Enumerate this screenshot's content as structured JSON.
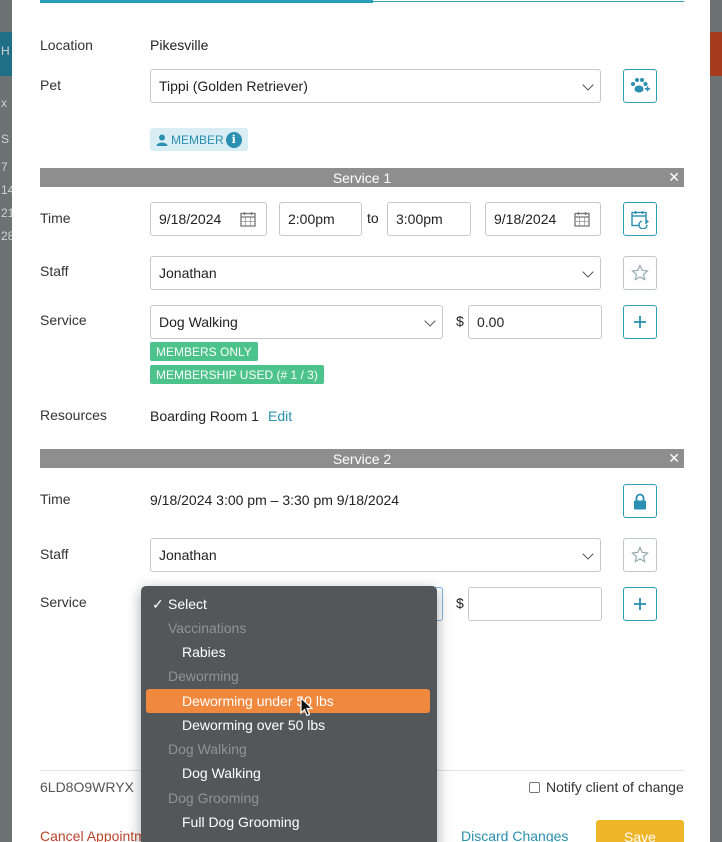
{
  "background": {
    "left_chars": [
      "H",
      "x",
      "S",
      "7",
      "14",
      "21",
      "28"
    ]
  },
  "form": {
    "location_label": "Location",
    "location_value": "Pikesville",
    "pet_label": "Pet",
    "pet_value": "Tippi (Golden Retriever)",
    "member_badge": "MEMBER"
  },
  "service1": {
    "title": "Service 1",
    "time_label": "Time",
    "start_date": "9/18/2024",
    "start_time": "2:00pm",
    "to_label": "to",
    "end_time": "3:00pm",
    "end_date": "9/18/2024",
    "staff_label": "Staff",
    "staff_value": "Jonathan",
    "service_label": "Service",
    "service_value": "Dog Walking",
    "currency": "$",
    "price": "0.00",
    "badges": [
      "MEMBERS ONLY",
      "MEMBERSHIP USED (# 1 / 3)"
    ],
    "resources_label": "Resources",
    "resources_value": "Boarding Room 1",
    "edit_label": "Edit"
  },
  "service2": {
    "title": "Service 2",
    "time_label": "Time",
    "time_value": "9/18/2024 3:00 pm – 3:30 pm 9/18/2024",
    "staff_label": "Staff",
    "staff_value": "Jonathan",
    "service_label": "Service",
    "currency": "$",
    "price": ""
  },
  "dropdown": {
    "selected": "Select",
    "items": [
      {
        "label": "Vaccinations",
        "type": "group"
      },
      {
        "label": "Rabies",
        "type": "option"
      },
      {
        "label": "Deworming",
        "type": "group"
      },
      {
        "label": "Deworming under 50 lbs",
        "type": "option",
        "highlighted": true
      },
      {
        "label": "Deworming over 50 lbs",
        "type": "option"
      },
      {
        "label": "Dog Walking",
        "type": "group"
      },
      {
        "label": "Dog Walking",
        "type": "option"
      },
      {
        "label": "Dog Grooming",
        "type": "group"
      },
      {
        "label": "Full Dog Grooming",
        "type": "option"
      }
    ]
  },
  "footer": {
    "code": "6LD8O9WRYX",
    "notify_label": "Notify client of change",
    "cancel_label": "Cancel Appointment",
    "discard_label": "Discard Changes",
    "save_label": "Save"
  },
  "colors": {
    "accent": "#2a9eb5",
    "badge_green": "#4cc38a",
    "highlight": "#f0883e",
    "save": "#f0b429"
  },
  "icons": [
    "add-pet-icon",
    "person-icon",
    "info-icon",
    "calendar-icon",
    "calendar-refresh-icon",
    "star-icon",
    "plus-icon",
    "lock-icon",
    "close-icon",
    "chevron-down-icon",
    "check-icon",
    "cursor-icon"
  ]
}
